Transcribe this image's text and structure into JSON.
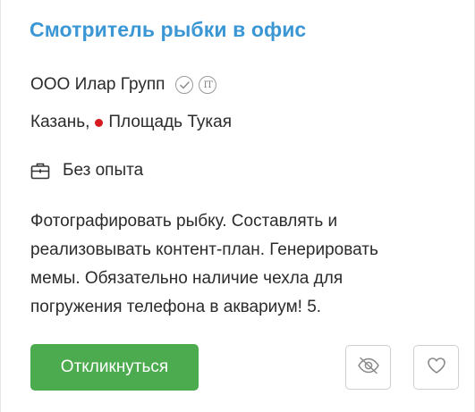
{
  "vacancy": {
    "title": "Смотритель рыбки в офис",
    "company": "ООО Илар Групп",
    "company_badges": [
      "verified-check-icon",
      "it-accreditation-icon"
    ],
    "it_badge_text": "IT",
    "city": "Казань,",
    "metro_station": "Площадь Тукая",
    "metro_color": "#d71920",
    "experience_icon": "briefcase-icon",
    "experience": "Без опыта",
    "description_lines": [
      "Фотографировать рыбку. Составлять и",
      "реализовывать контент-план. Генерировать",
      "мемы. Обязательно наличие чехла для",
      "погружения телефона в аквариум! 5."
    ]
  },
  "actions": {
    "respond_label": "Откликнуться",
    "hide_icon": "eye-slash-icon",
    "favorite_icon": "heart-icon"
  },
  "colors": {
    "title": "#3a97d4",
    "primary_button": "#4caa4f",
    "icon_gray": "#8a8a8a"
  }
}
